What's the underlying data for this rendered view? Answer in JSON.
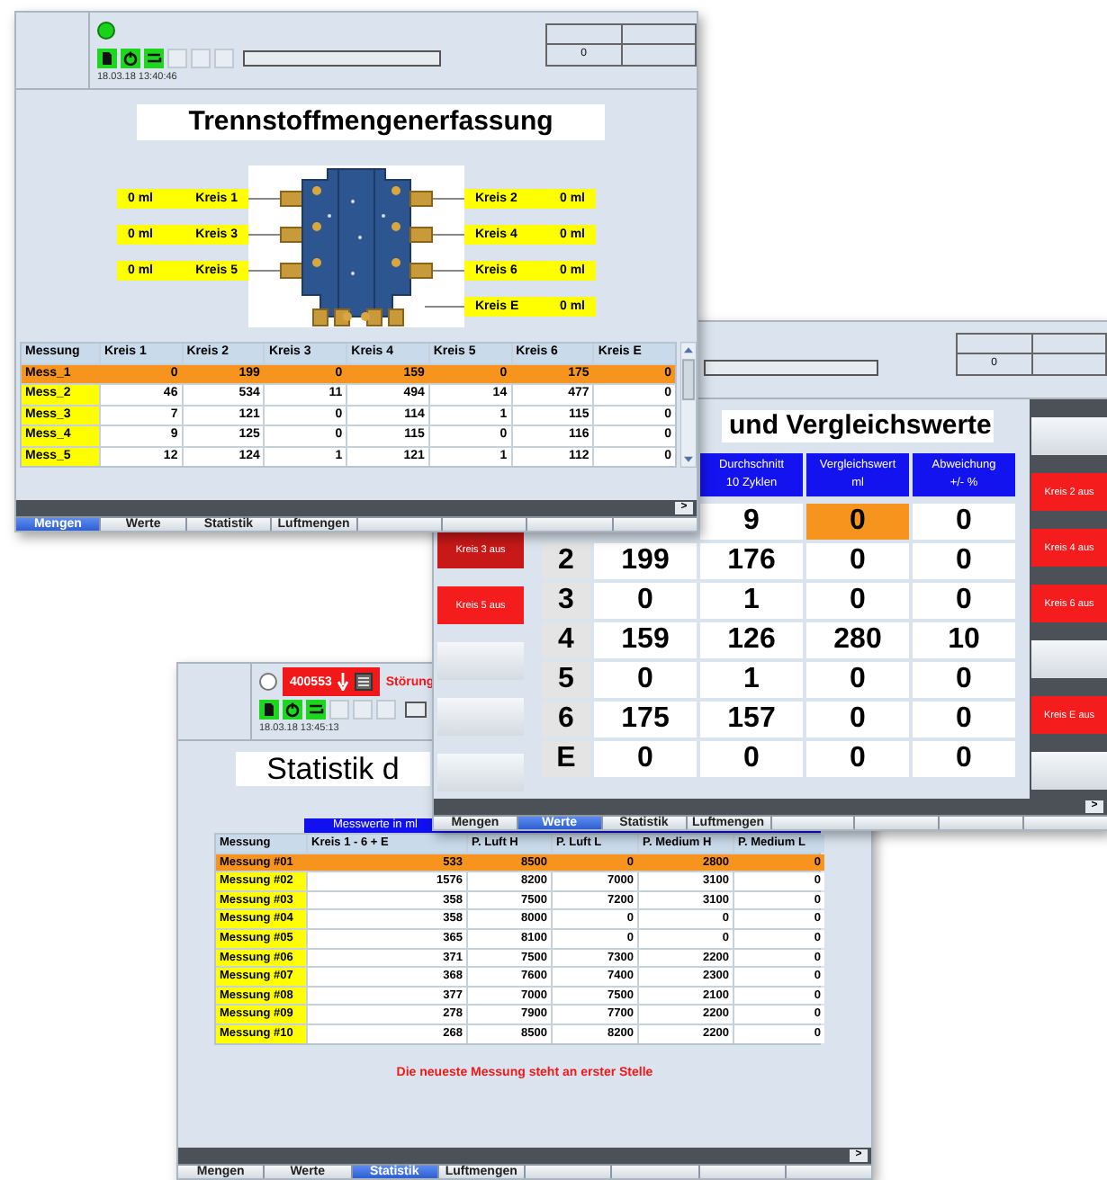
{
  "windows": [
    {
      "kind": "mengen",
      "header": {
        "indicator": {
          "on": true
        },
        "toolbar": true,
        "date": "18.03.18 13:40:46",
        "display_value": "0"
      },
      "title": "Trennstoffmengenerfassung",
      "left_labels": [
        {
          "value": "0 ml",
          "name": "Kreis 1"
        },
        {
          "value": "0 ml",
          "name": "Kreis 3"
        },
        {
          "value": "0 ml",
          "name": "Kreis 5"
        }
      ],
      "right_labels": [
        {
          "name": "Kreis 2",
          "value": "0 ml"
        },
        {
          "name": "Kreis 4",
          "value": "0 ml"
        },
        {
          "name": "Kreis 6",
          "value": "0 ml"
        },
        {
          "name": "Kreis E",
          "value": "0 ml"
        }
      ],
      "table": {
        "columns": [
          "Messung",
          "Kreis 1",
          "Kreis 2",
          "Kreis 3",
          "Kreis 4",
          "Kreis 5",
          "Kreis 6",
          "Kreis E"
        ],
        "rows": [
          {
            "label": "Mess_1",
            "values": [
              "0",
              "199",
              "0",
              "159",
              "0",
              "175",
              "0"
            ],
            "selected": true
          },
          {
            "label": "Mess_2",
            "values": [
              "46",
              "534",
              "11",
              "494",
              "14",
              "477",
              "0"
            ],
            "selected": false
          },
          {
            "label": "Mess_3",
            "values": [
              "7",
              "121",
              "0",
              "114",
              "1",
              "115",
              "0"
            ],
            "selected": false
          },
          {
            "label": "Mess_4",
            "values": [
              "9",
              "125",
              "0",
              "115",
              "0",
              "116",
              "0"
            ],
            "selected": false
          },
          {
            "label": "Mess_5",
            "values": [
              "12",
              "124",
              "1",
              "121",
              "1",
              "112",
              "0"
            ],
            "selected": false
          }
        ]
      },
      "scroll_button": ">",
      "tabs": [
        {
          "label": "Mengen",
          "selected": true
        },
        {
          "label": "Werte",
          "selected": false
        },
        {
          "label": "Statistik",
          "selected": false
        },
        {
          "label": "Luftmengen",
          "selected": false
        }
      ]
    },
    {
      "kind": "werte",
      "header": {
        "display_value": "0"
      },
      "title": "und Vergleichswerte",
      "left_buttons": [
        {
          "label": "Kreis 3 aus",
          "active": true,
          "pressed": true
        },
        {
          "label": "Kreis 5 aus",
          "active": true,
          "pressed": false
        },
        {
          "active": false,
          "pressed": false
        },
        {
          "active": false,
          "pressed": false
        },
        {
          "active": false,
          "pressed": false
        }
      ],
      "right_buttons": [
        {
          "active": false,
          "pressed": false
        },
        {
          "label": "Kreis 2 aus",
          "active": true,
          "pressed": false
        },
        {
          "label": "Kreis 4 aus",
          "active": true,
          "pressed": false
        },
        {
          "label": "Kreis 6 aus",
          "active": true,
          "pressed": false
        },
        {
          "active": false,
          "pressed": false
        },
        {
          "label": "Kreis E aus",
          "active": true,
          "pressed": false
        },
        {
          "active": false,
          "pressed": false
        }
      ],
      "table": {
        "columns": [
          "Durchschnitt\n10 Zyklen",
          "Vergleichswert\nml",
          "Abweichung\n+/- %"
        ],
        "rows": [
          {
            "cells": [
              {
                "text": "9",
                "highlighted": false
              },
              {
                "text": "0",
                "highlighted": true
              },
              {
                "text": "0",
                "highlighted": false
              }
            ]
          },
          {
            "kreis": "2",
            "cells": [
              {
                "text": "199",
                "highlighted": false
              },
              {
                "text": "176",
                "highlighted": false
              },
              {
                "text": "0",
                "highlighted": false
              },
              {
                "text": "0",
                "highlighted": false
              }
            ]
          },
          {
            "kreis": "3",
            "cells": [
              {
                "text": "0",
                "highlighted": false
              },
              {
                "text": "1",
                "highlighted": false
              },
              {
                "text": "0",
                "highlighted": false
              },
              {
                "text": "0",
                "highlighted": false
              }
            ]
          },
          {
            "kreis": "4",
            "cells": [
              {
                "text": "159",
                "highlighted": false
              },
              {
                "text": "126",
                "highlighted": false
              },
              {
                "text": "280",
                "highlighted": false
              },
              {
                "text": "10",
                "highlighted": false
              }
            ]
          },
          {
            "kreis": "5",
            "cells": [
              {
                "text": "0",
                "highlighted": false
              },
              {
                "text": "1",
                "highlighted": false
              },
              {
                "text": "0",
                "highlighted": false
              },
              {
                "text": "0",
                "highlighted": false
              }
            ]
          },
          {
            "kreis": "6",
            "cells": [
              {
                "text": "175",
                "highlighted": false
              },
              {
                "text": "157",
                "highlighted": false
              },
              {
                "text": "0",
                "highlighted": false
              },
              {
                "text": "0",
                "highlighted": false
              }
            ]
          },
          {
            "kreis": "E",
            "cells": [
              {
                "text": "0",
                "highlighted": false
              },
              {
                "text": "0",
                "highlighted": false
              },
              {
                "text": "0",
                "highlighted": false
              },
              {
                "text": "0",
                "highlighted": false
              }
            ]
          }
        ]
      },
      "scroll_button": ">",
      "tabs": [
        {
          "label": "Mengen",
          "selected": false
        },
        {
          "label": "Werte",
          "selected": true
        },
        {
          "label": "Statistik",
          "selected": false
        },
        {
          "label": "Luftmengen",
          "selected": false
        }
      ]
    },
    {
      "kind": "statistik",
      "header": {
        "indicator": {
          "on": false
        },
        "alarm": {
          "code": "400553",
          "text": "Störung"
        },
        "toolbar": true,
        "date": "18.03.18 13:45:13"
      },
      "title": "Statistik d",
      "group_header": "Messwerte in ml",
      "table": {
        "columns": [
          "Messung",
          "Kreis 1 - 6 + E",
          "P. Luft H",
          "P. Luft L",
          "P. Medium H",
          "P. Medium L"
        ],
        "rows": [
          {
            "label": "Messung #01",
            "values": [
              "533",
              "8500",
              "0",
              "2800",
              "0"
            ],
            "selected": true
          },
          {
            "label": "Messung #02",
            "values": [
              "1576",
              "8200",
              "7000",
              "3100",
              "0"
            ],
            "selected": false
          },
          {
            "label": "Messung #03",
            "values": [
              "358",
              "7500",
              "7200",
              "3100",
              "0"
            ],
            "selected": false
          },
          {
            "label": "Messung #04",
            "values": [
              "358",
              "8000",
              "0",
              "0",
              "0"
            ],
            "selected": false
          },
          {
            "label": "Messung #05",
            "values": [
              "365",
              "8100",
              "0",
              "0",
              "0"
            ],
            "selected": false
          },
          {
            "label": "Messung #06",
            "values": [
              "371",
              "7500",
              "7300",
              "2200",
              "0"
            ],
            "selected": false
          },
          {
            "label": "Messung #07",
            "values": [
              "368",
              "7600",
              "7400",
              "2300",
              "0"
            ],
            "selected": false
          },
          {
            "label": "Messung #08",
            "values": [
              "377",
              "7000",
              "7500",
              "2100",
              "0"
            ],
            "selected": false
          },
          {
            "label": "Messung #09",
            "values": [
              "278",
              "7900",
              "7700",
              "2200",
              "0"
            ],
            "selected": false
          },
          {
            "label": "Messung #10",
            "values": [
              "268",
              "8500",
              "8200",
              "2200",
              "0"
            ],
            "selected": false
          }
        ]
      },
      "note": "Die neueste Messung steht an erster Stelle",
      "scroll_button": ">",
      "tabs": [
        {
          "label": "Mengen",
          "selected": false
        },
        {
          "label": "Werte",
          "selected": false
        },
        {
          "label": "Statistik",
          "selected": true
        },
        {
          "label": "Luftmengen",
          "selected": false
        }
      ]
    }
  ]
}
